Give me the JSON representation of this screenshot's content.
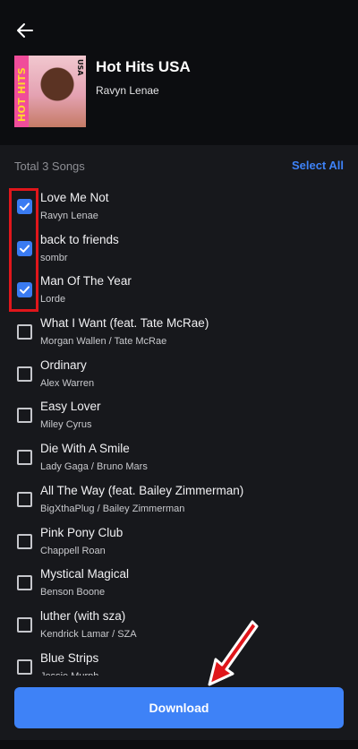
{
  "header": {
    "back_icon": "arrow-left-icon",
    "cover": {
      "badge": "HOT HITS",
      "region": "USA"
    },
    "title": "Hot Hits USA",
    "artist": "Ravyn Lenae"
  },
  "list_header": {
    "total_label": "Total 3 Songs",
    "select_all_label": "Select All"
  },
  "songs": [
    {
      "title": "Love Me Not",
      "artist": "Ravyn Lenae",
      "checked": true
    },
    {
      "title": "back to friends",
      "artist": "sombr",
      "checked": true
    },
    {
      "title": "Man Of The Year",
      "artist": "Lorde",
      "checked": true
    },
    {
      "title": "What I Want (feat. Tate McRae)",
      "artist": "Morgan Wallen / Tate McRae",
      "checked": false
    },
    {
      "title": "Ordinary",
      "artist": "Alex Warren",
      "checked": false
    },
    {
      "title": "Easy Lover",
      "artist": "Miley Cyrus",
      "checked": false
    },
    {
      "title": "Die With A Smile",
      "artist": "Lady Gaga / Bruno Mars",
      "checked": false
    },
    {
      "title": "All The Way (feat. Bailey Zimmerman)",
      "artist": "BigXthaPlug / Bailey Zimmerman",
      "checked": false
    },
    {
      "title": "Pink Pony Club",
      "artist": "Chappell Roan",
      "checked": false
    },
    {
      "title": "Mystical Magical",
      "artist": "Benson Boone",
      "checked": false
    },
    {
      "title": "luther (with sza)",
      "artist": "Kendrick Lamar / SZA",
      "checked": false
    },
    {
      "title": "Blue Strips",
      "artist": "Jessie Murph",
      "checked": false
    }
  ],
  "download_label": "Download",
  "colors": {
    "accent": "#3e82f7",
    "checkbox_checked": "#3a7bf2",
    "annotation_red": "#e0161b",
    "background": "#0c0d10",
    "sheet": "#17181c"
  }
}
